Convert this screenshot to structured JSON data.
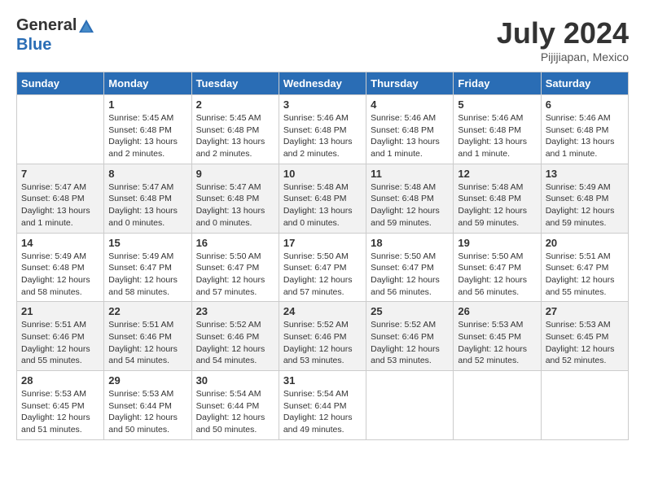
{
  "header": {
    "logo": {
      "general": "General",
      "blue": "Blue"
    },
    "title": "July 2024",
    "location": "Pijijiapan, Mexico"
  },
  "calendar": {
    "days_of_week": [
      "Sunday",
      "Monday",
      "Tuesday",
      "Wednesday",
      "Thursday",
      "Friday",
      "Saturday"
    ],
    "weeks": [
      [
        {
          "day": "",
          "info": ""
        },
        {
          "day": "1",
          "info": "Sunrise: 5:45 AM\nSunset: 6:48 PM\nDaylight: 13 hours\nand 2 minutes."
        },
        {
          "day": "2",
          "info": "Sunrise: 5:45 AM\nSunset: 6:48 PM\nDaylight: 13 hours\nand 2 minutes."
        },
        {
          "day": "3",
          "info": "Sunrise: 5:46 AM\nSunset: 6:48 PM\nDaylight: 13 hours\nand 2 minutes."
        },
        {
          "day": "4",
          "info": "Sunrise: 5:46 AM\nSunset: 6:48 PM\nDaylight: 13 hours\nand 1 minute."
        },
        {
          "day": "5",
          "info": "Sunrise: 5:46 AM\nSunset: 6:48 PM\nDaylight: 13 hours\nand 1 minute."
        },
        {
          "day": "6",
          "info": "Sunrise: 5:46 AM\nSunset: 6:48 PM\nDaylight: 13 hours\nand 1 minute."
        }
      ],
      [
        {
          "day": "7",
          "info": "Sunrise: 5:47 AM\nSunset: 6:48 PM\nDaylight: 13 hours\nand 1 minute."
        },
        {
          "day": "8",
          "info": "Sunrise: 5:47 AM\nSunset: 6:48 PM\nDaylight: 13 hours\nand 0 minutes."
        },
        {
          "day": "9",
          "info": "Sunrise: 5:47 AM\nSunset: 6:48 PM\nDaylight: 13 hours\nand 0 minutes."
        },
        {
          "day": "10",
          "info": "Sunrise: 5:48 AM\nSunset: 6:48 PM\nDaylight: 13 hours\nand 0 minutes."
        },
        {
          "day": "11",
          "info": "Sunrise: 5:48 AM\nSunset: 6:48 PM\nDaylight: 12 hours\nand 59 minutes."
        },
        {
          "day": "12",
          "info": "Sunrise: 5:48 AM\nSunset: 6:48 PM\nDaylight: 12 hours\nand 59 minutes."
        },
        {
          "day": "13",
          "info": "Sunrise: 5:49 AM\nSunset: 6:48 PM\nDaylight: 12 hours\nand 59 minutes."
        }
      ],
      [
        {
          "day": "14",
          "info": "Sunrise: 5:49 AM\nSunset: 6:48 PM\nDaylight: 12 hours\nand 58 minutes."
        },
        {
          "day": "15",
          "info": "Sunrise: 5:49 AM\nSunset: 6:47 PM\nDaylight: 12 hours\nand 58 minutes."
        },
        {
          "day": "16",
          "info": "Sunrise: 5:50 AM\nSunset: 6:47 PM\nDaylight: 12 hours\nand 57 minutes."
        },
        {
          "day": "17",
          "info": "Sunrise: 5:50 AM\nSunset: 6:47 PM\nDaylight: 12 hours\nand 57 minutes."
        },
        {
          "day": "18",
          "info": "Sunrise: 5:50 AM\nSunset: 6:47 PM\nDaylight: 12 hours\nand 56 minutes."
        },
        {
          "day": "19",
          "info": "Sunrise: 5:50 AM\nSunset: 6:47 PM\nDaylight: 12 hours\nand 56 minutes."
        },
        {
          "day": "20",
          "info": "Sunrise: 5:51 AM\nSunset: 6:47 PM\nDaylight: 12 hours\nand 55 minutes."
        }
      ],
      [
        {
          "day": "21",
          "info": "Sunrise: 5:51 AM\nSunset: 6:46 PM\nDaylight: 12 hours\nand 55 minutes."
        },
        {
          "day": "22",
          "info": "Sunrise: 5:51 AM\nSunset: 6:46 PM\nDaylight: 12 hours\nand 54 minutes."
        },
        {
          "day": "23",
          "info": "Sunrise: 5:52 AM\nSunset: 6:46 PM\nDaylight: 12 hours\nand 54 minutes."
        },
        {
          "day": "24",
          "info": "Sunrise: 5:52 AM\nSunset: 6:46 PM\nDaylight: 12 hours\nand 53 minutes."
        },
        {
          "day": "25",
          "info": "Sunrise: 5:52 AM\nSunset: 6:46 PM\nDaylight: 12 hours\nand 53 minutes."
        },
        {
          "day": "26",
          "info": "Sunrise: 5:53 AM\nSunset: 6:45 PM\nDaylight: 12 hours\nand 52 minutes."
        },
        {
          "day": "27",
          "info": "Sunrise: 5:53 AM\nSunset: 6:45 PM\nDaylight: 12 hours\nand 52 minutes."
        }
      ],
      [
        {
          "day": "28",
          "info": "Sunrise: 5:53 AM\nSunset: 6:45 PM\nDaylight: 12 hours\nand 51 minutes."
        },
        {
          "day": "29",
          "info": "Sunrise: 5:53 AM\nSunset: 6:44 PM\nDaylight: 12 hours\nand 50 minutes."
        },
        {
          "day": "30",
          "info": "Sunrise: 5:54 AM\nSunset: 6:44 PM\nDaylight: 12 hours\nand 50 minutes."
        },
        {
          "day": "31",
          "info": "Sunrise: 5:54 AM\nSunset: 6:44 PM\nDaylight: 12 hours\nand 49 minutes."
        },
        {
          "day": "",
          "info": ""
        },
        {
          "day": "",
          "info": ""
        },
        {
          "day": "",
          "info": ""
        }
      ]
    ]
  }
}
